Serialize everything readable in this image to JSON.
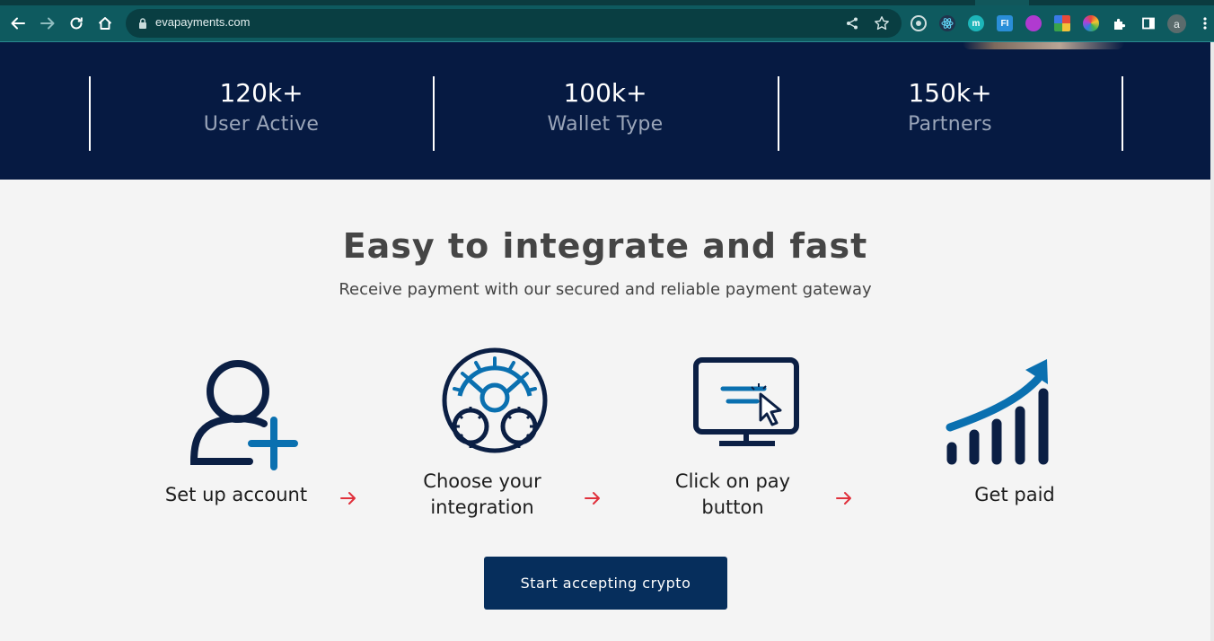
{
  "browser": {
    "url": "evapayments.com",
    "profile_initial": "a",
    "extensions": [
      "target-extension-icon",
      "react-devtools-icon",
      "m-extension-icon",
      "fi-extension-icon",
      "purple-extension-icon",
      "grid-extension-icon",
      "color-wheel-extension-icon",
      "puzzle-icon"
    ]
  },
  "stats": [
    {
      "value": "120k+",
      "label": "User Active"
    },
    {
      "value": "100k+",
      "label": "Wallet Type"
    },
    {
      "value": "150k+",
      "label": "Partners"
    }
  ],
  "integrate": {
    "title": "Easy to integrate and fast",
    "subtitle": "Receive payment with our secured and reliable payment gateway",
    "steps": [
      {
        "label": "Set up account",
        "icon": "add-user-icon"
      },
      {
        "label": "Choose your integration",
        "line1": "Choose your",
        "line2": "integration",
        "icon": "integration-gear-icon"
      },
      {
        "label": "Click on pay button",
        "line1": "Click on pay",
        "line2": "button",
        "icon": "monitor-click-icon"
      },
      {
        "label": "Get paid",
        "icon": "growth-chart-icon"
      }
    ],
    "cta_label": "Start accepting crypto"
  },
  "colors": {
    "navy": "#061a42",
    "brand_blue": "#0a70b0",
    "icon_dark": "#0b1f44",
    "arrow_red": "#e0313c",
    "cta_bg": "#062e5c",
    "chrome_teal": "#0e5a5f"
  }
}
